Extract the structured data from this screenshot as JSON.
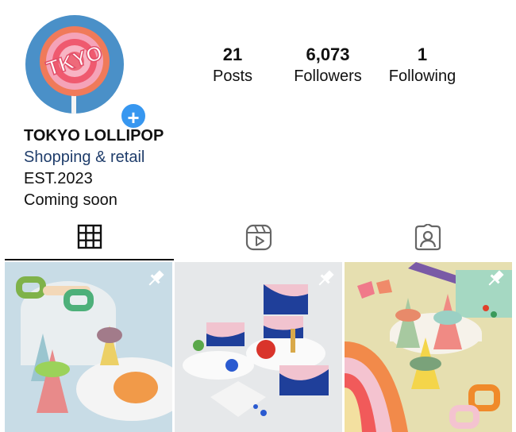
{
  "profile": {
    "avatar_text": "TKYO",
    "add_story_glyph": "+",
    "name": "TOKYO LOLLIPOP",
    "category": "Shopping & retail",
    "bio_lines": [
      "EST.2023",
      "Coming soon"
    ]
  },
  "stats": [
    {
      "number": "21",
      "label": "Posts"
    },
    {
      "number": "6,073",
      "label": "Followers"
    },
    {
      "number": "1",
      "label": "Following"
    }
  ],
  "tabs": [
    {
      "icon": "grid-icon",
      "active": true
    },
    {
      "icon": "reels-icon",
      "active": false
    },
    {
      "icon": "tagged-icon",
      "active": false
    }
  ],
  "posts": [
    {
      "icon": "pin-icon",
      "pinned": true,
      "bg": "#c8dce6"
    },
    {
      "icon": "pin-icon",
      "pinned": true,
      "bg": "#e6e8ea"
    },
    {
      "icon": "pin-icon",
      "pinned": true,
      "bg": "#e6dfb0"
    }
  ],
  "colors": {
    "accent": "#3797f0",
    "category_text": "#1f3d6b",
    "avatar_bg": "#4a90c8"
  }
}
